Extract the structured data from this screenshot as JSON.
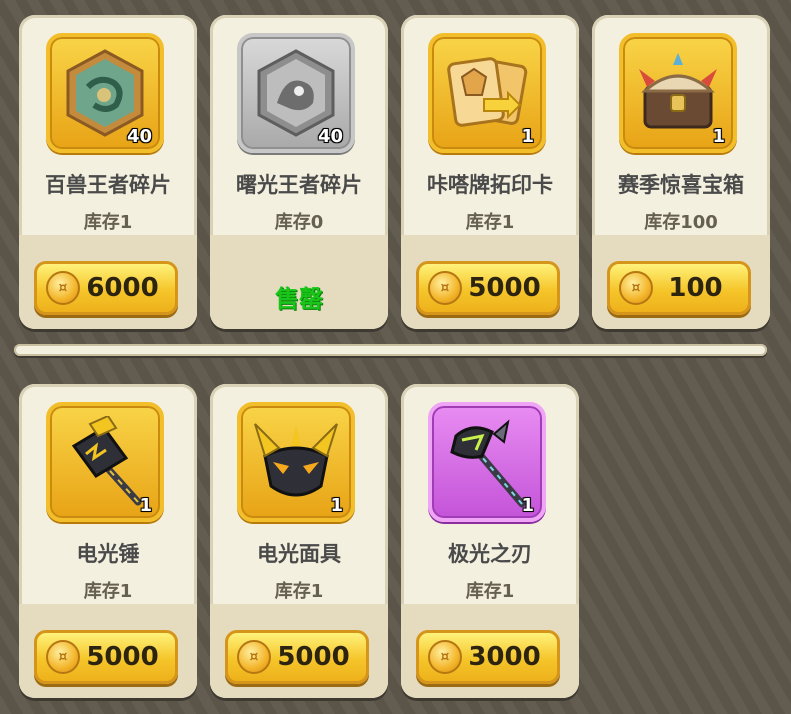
{
  "items": [
    {
      "name": "百兽王者碎片",
      "stock": "库存1",
      "qty": "40",
      "price": "6000",
      "sold": false,
      "frame": "gold",
      "icon": "beast-king-shard-icon"
    },
    {
      "name": "曙光王者碎片",
      "stock": "库存0",
      "qty": "40",
      "price": "",
      "sold": true,
      "sold_label": "售罄",
      "frame": "gray",
      "icon": "dawn-king-shard-icon"
    },
    {
      "name": "咔嗒牌拓印卡",
      "stock": "库存1",
      "qty": "1",
      "price": "5000",
      "sold": false,
      "frame": "gold",
      "icon": "card-imprint-icon"
    },
    {
      "name": "赛季惊喜宝箱",
      "stock": "库存100",
      "qty": "1",
      "price": "100",
      "sold": false,
      "frame": "gold",
      "icon": "season-chest-icon"
    },
    {
      "name": "电光锤",
      "stock": "库存1",
      "qty": "1",
      "price": "5000",
      "sold": false,
      "frame": "gold",
      "icon": "lightning-hammer-icon"
    },
    {
      "name": "电光面具",
      "stock": "库存1",
      "qty": "1",
      "price": "5000",
      "sold": false,
      "frame": "gold",
      "icon": "lightning-mask-icon"
    },
    {
      "name": "极光之刃",
      "stock": "库存1",
      "qty": "1",
      "price": "3000",
      "sold": false,
      "frame": "purple",
      "icon": "aurora-axe-icon"
    }
  ],
  "colors": {
    "sold": "#18c518",
    "gold_button": "#f5c52a",
    "card_bg": "#f4f0df",
    "background": "#5e574a"
  }
}
